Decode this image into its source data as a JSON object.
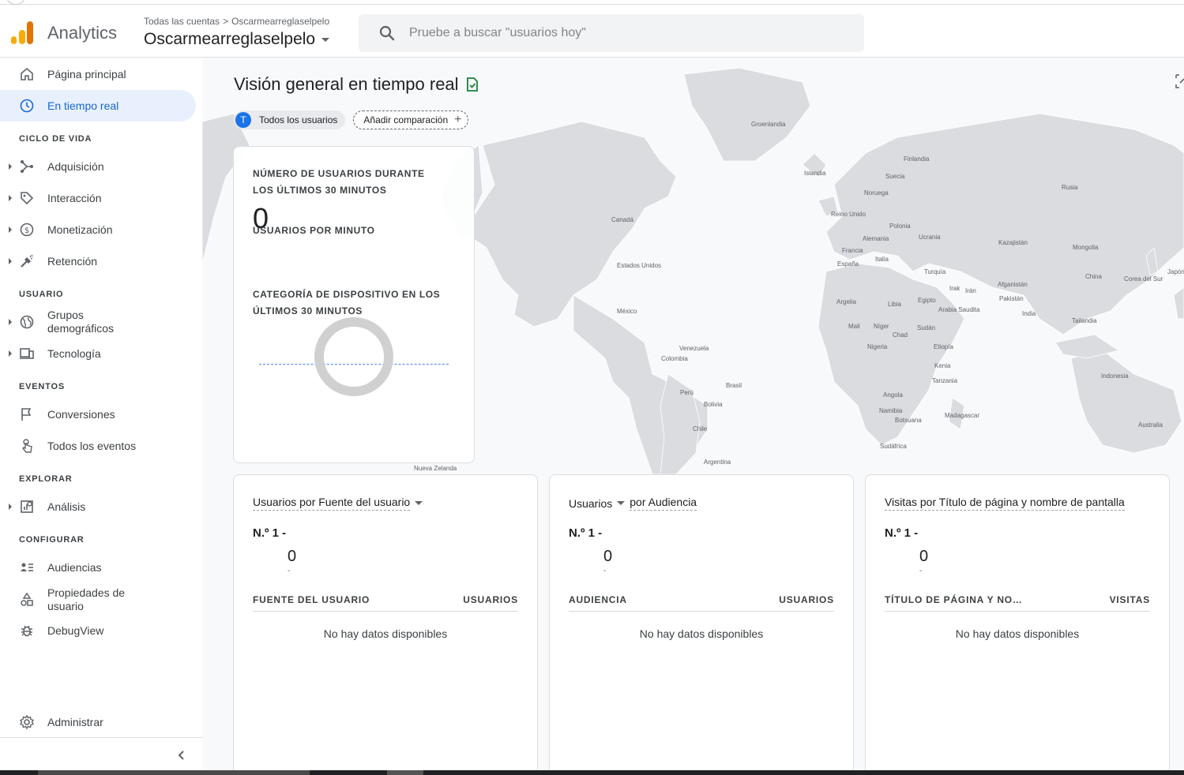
{
  "header": {
    "app_name": "Analytics",
    "breadcrumb": [
      "Todas las cuentas",
      ">",
      "Oscarmearreglaselpelo"
    ],
    "account": "Oscarmearreglaselpelo",
    "search_placeholder": "Pruebe a buscar \"usuarios hoy\""
  },
  "sidebar": {
    "items": [
      {
        "label": "Página principal",
        "icon": "home-icon"
      },
      {
        "label": "En tiempo real",
        "icon": "clock-icon",
        "active": true
      },
      {
        "label": "Adquisición",
        "icon": "acquisition-icon"
      },
      {
        "label": "Interacción",
        "icon": "tag-icon"
      },
      {
        "label": "Monetización",
        "icon": "dollar-icon"
      },
      {
        "label": "Retención",
        "icon": "retention-icon"
      },
      {
        "label": "Grupos demográficos",
        "icon": "globe-icon"
      },
      {
        "label": "Tecnología",
        "icon": "devices-icon"
      },
      {
        "label": "Conversiones",
        "icon": "flag-icon"
      },
      {
        "label": "Todos los eventos",
        "icon": "touch-icon"
      },
      {
        "label": "Análisis",
        "icon": "analysis-icon"
      },
      {
        "label": "Audiencias",
        "icon": "audience-icon"
      },
      {
        "label": "Propiedades de usuario",
        "icon": "shapes-icon"
      },
      {
        "label": "DebugView",
        "icon": "bug-icon"
      },
      {
        "label": "Administrar",
        "icon": "gear-icon"
      }
    ],
    "sections": {
      "lifecycle": "CICLO DE VIDA",
      "user": "USUARIO",
      "events": "EVENTOS",
      "explore": "EXPLORAR",
      "configure": "CONFIGURAR"
    }
  },
  "main": {
    "title": "Visión general en tiempo real",
    "chips": {
      "avatar": "T",
      "all_users": "Todos los usuarios",
      "add_compare": "Añadir comparación"
    },
    "realtime_card": {
      "users_heading": "NÚMERO DE USUARIOS DURANTE LOS ÚLTIMOS 30 MINUTOS",
      "users_value": "0",
      "per_minute_heading": "USUARIOS POR MINUTO",
      "device_heading": "CATEGORÍA DE DISPOSITIVO EN LOS ÚLTIMOS 30 MINUTOS"
    },
    "cards": [
      {
        "title_a": "Usuarios por Fuente del usuario",
        "title_b": "",
        "rank": "N.º 1  -",
        "value": "0",
        "col_left": "FUENTE DEL USUARIO",
        "col_right": "USUARIOS",
        "empty": "No hay datos disponibles"
      },
      {
        "title_a": "Usuarios",
        "title_b": "por Audiencia",
        "rank": "N.º 1  -",
        "value": "0",
        "col_left": "AUDIENCIA",
        "col_right": "USUARIOS",
        "empty": "No hay datos disponibles"
      },
      {
        "title_a": "Visitas por Título de página y nombre de pantalla",
        "title_b": "",
        "rank": "N.º 1  -",
        "value": "0",
        "col_left": "TÍTULO DE PÁGINA Y NO…",
        "col_right": "VISITAS",
        "empty": "No hay datos disponibles"
      }
    ],
    "map_labels": [
      "Groenlandia",
      "Islandia",
      "Finlandia",
      "Suecia",
      "Noruega",
      "Rusia",
      "Canadá",
      "Reino Unido",
      "Polonia",
      "Alemania",
      "Ucrania",
      "Kazajistán",
      "Francia",
      "Italia",
      "Mongolia",
      "España",
      "Turquía",
      "China",
      "Corea del Sur",
      "Japón",
      "Estados Unidos",
      "Irak",
      "Irán",
      "Afganistán",
      "Pakistán",
      "Argelia",
      "Libia",
      "Egipto",
      "Arabia Saudita",
      "India",
      "Tailandia",
      "México",
      "Mali",
      "Níger",
      "Chad",
      "Sudán",
      "Venezuela",
      "Colombia",
      "Nigeria",
      "Etiopía",
      "Kenia",
      "Indonesia",
      "Perú",
      "Brasil",
      "Tanzania",
      "Bolivia",
      "Angola",
      "Namibia",
      "Madagascar",
      "Botsuana",
      "Chile",
      "Australia",
      "Sudáfrica",
      "Argentina",
      "Nueva Zelanda"
    ],
    "donut_color": "#d0d0d0",
    "accent": "#1a73e8"
  }
}
